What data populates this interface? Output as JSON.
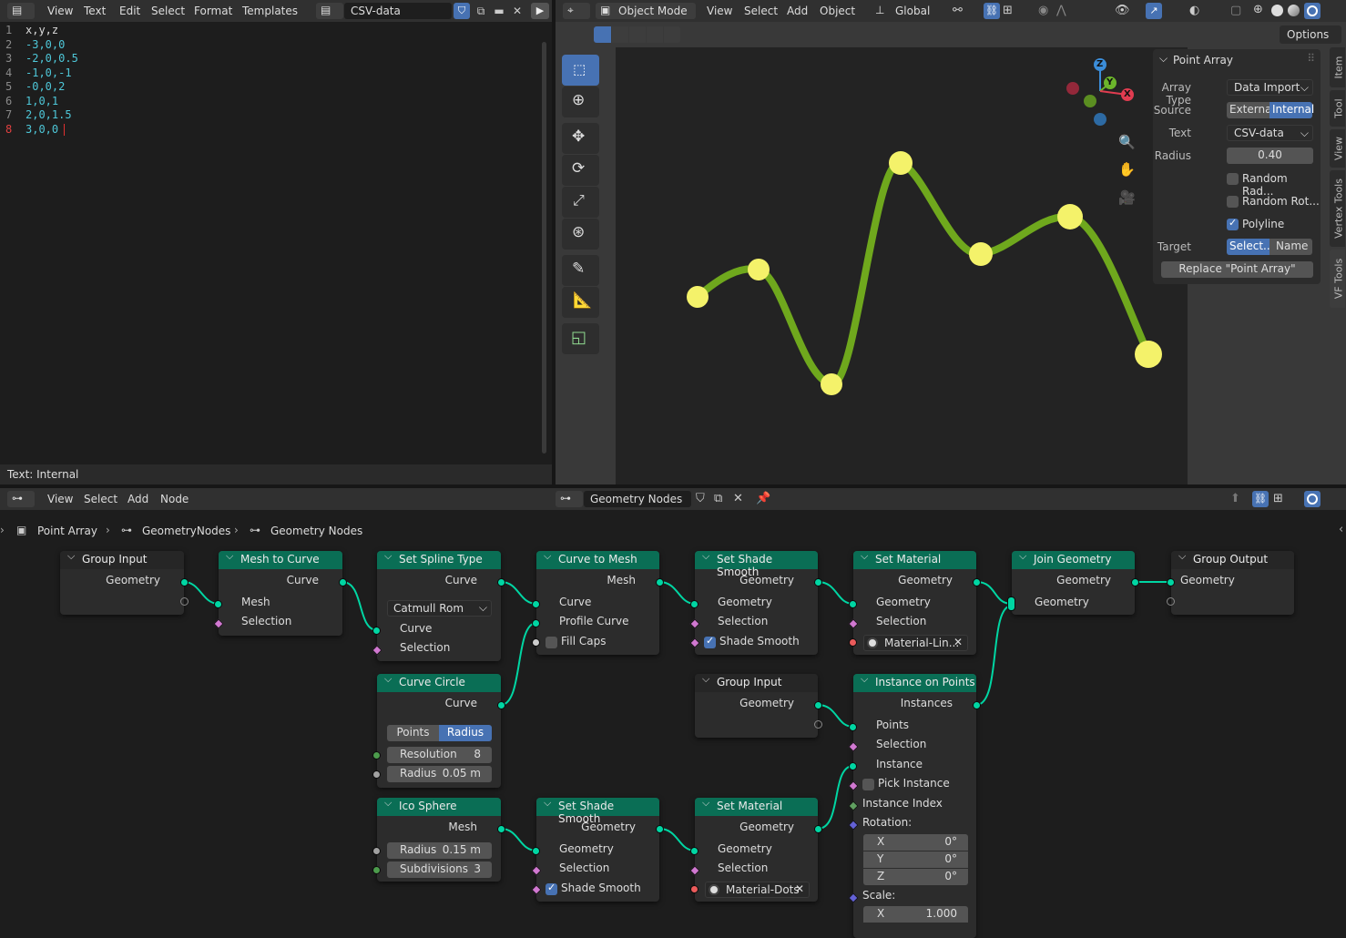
{
  "text_editor": {
    "menus": [
      "View",
      "Text",
      "Edit",
      "Select",
      "Format",
      "Templates"
    ],
    "text_name": "CSV-data",
    "lines": [
      {
        "n": "1",
        "t": "x,y,z"
      },
      {
        "n": "2",
        "t": "-3,0,0"
      },
      {
        "n": "3",
        "t": "-2,0,0.5"
      },
      {
        "n": "4",
        "t": "-1,0,-1"
      },
      {
        "n": "5",
        "t": "-0,0,2"
      },
      {
        "n": "6",
        "t": " 1,0,1"
      },
      {
        "n": "7",
        "t": " 2,0,1.5"
      },
      {
        "n": "8",
        "t": " 3,0,0"
      }
    ],
    "status": "Text: Internal"
  },
  "viewport": {
    "mode": "Object Mode",
    "menus": [
      "View",
      "Select",
      "Add",
      "Object"
    ],
    "orientation": "Global",
    "options": "Options",
    "axes": {
      "z": "Z",
      "y": "Y",
      "x": "X"
    },
    "tabs": [
      "Item",
      "Tool",
      "View",
      "Vertex Tools",
      "VF Tools"
    ],
    "curve_color": "#6fa81d",
    "point_color": "#f4f26a"
  },
  "point_array": {
    "title": "Point Array",
    "array_type_label": "Array Type",
    "array_type": "Data Import ...",
    "source_label": "Source",
    "source_options": [
      "External",
      "Internal"
    ],
    "source_selected": "Internal",
    "text_label": "Text",
    "text_value": "CSV-data",
    "radius_label": "Radius",
    "radius_value": "0.40",
    "random_radius": "Random Rad...",
    "random_rotation": "Random Rot...",
    "polyline": "Polyline",
    "polyline_checked": true,
    "target_label": "Target",
    "target_options": [
      "Select...",
      "Name"
    ],
    "replace_button": "Replace \"Point Array\""
  },
  "node_editor": {
    "menus": [
      "View",
      "Select",
      "Add",
      "Node"
    ],
    "tree_name": "Geometry Nodes",
    "breadcrumb": [
      "Point Array",
      "GeometryNodes",
      "Geometry Nodes"
    ],
    "nodes": {
      "group_input_1": {
        "title": "Group Input",
        "out": "Geometry"
      },
      "mesh_to_curve": {
        "title": "Mesh to Curve",
        "out": "Curve",
        "in1": "Mesh",
        "in2": "Selection"
      },
      "set_spline_type": {
        "title": "Set Spline Type",
        "out": "Curve",
        "dropdown": "Catmull Rom",
        "in1": "Curve",
        "in2": "Selection"
      },
      "curve_to_mesh": {
        "title": "Curve to Mesh",
        "out": "Mesh",
        "in1": "Curve",
        "in2": "Profile Curve",
        "in3": "Fill Caps"
      },
      "set_shade_smooth_1": {
        "title": "Set Shade Smooth",
        "out": "Geometry",
        "in1": "Geometry",
        "in2": "Selection",
        "in3": "Shade Smooth"
      },
      "set_material_1": {
        "title": "Set Material",
        "out": "Geometry",
        "in1": "Geometry",
        "in2": "Selection",
        "material": "Material-Lin..."
      },
      "join_geometry": {
        "title": "Join Geometry",
        "out": "Geometry",
        "in1": "Geometry"
      },
      "group_output": {
        "title": "Group Output",
        "in1": "Geometry"
      },
      "curve_circle": {
        "title": "Curve Circle",
        "out": "Curve",
        "mode_options": [
          "Points",
          "Radius"
        ],
        "mode_selected": "Radius",
        "resolution_label": "Resolution",
        "resolution": "8",
        "radius_label": "Radius",
        "radius": "0.05 m"
      },
      "group_input_2": {
        "title": "Group Input",
        "out": "Geometry"
      },
      "instance_on_points": {
        "title": "Instance on Points",
        "out": "Instances",
        "in1": "Points",
        "in2": "Selection",
        "in3": "Instance",
        "in4": "Pick Instance",
        "in5": "Instance Index",
        "rotation_label": "Rotation:",
        "rot": [
          {
            "axis": "X",
            "v": "0°"
          },
          {
            "axis": "Y",
            "v": "0°"
          },
          {
            "axis": "Z",
            "v": "0°"
          }
        ],
        "scale_label": "Scale:",
        "scale_x_axis": "X",
        "scale_x": "1.000"
      },
      "ico_sphere": {
        "title": "Ico Sphere",
        "out": "Mesh",
        "radius_label": "Radius",
        "radius": "0.15 m",
        "subdiv_label": "Subdivisions",
        "subdiv": "3"
      },
      "set_shade_smooth_2": {
        "title": "Set Shade Smooth",
        "out": "Geometry",
        "in1": "Geometry",
        "in2": "Selection",
        "in3": "Shade Smooth"
      },
      "set_material_2": {
        "title": "Set Material",
        "out": "Geometry",
        "in1": "Geometry",
        "in2": "Selection",
        "material": "Material-Dots"
      }
    }
  }
}
